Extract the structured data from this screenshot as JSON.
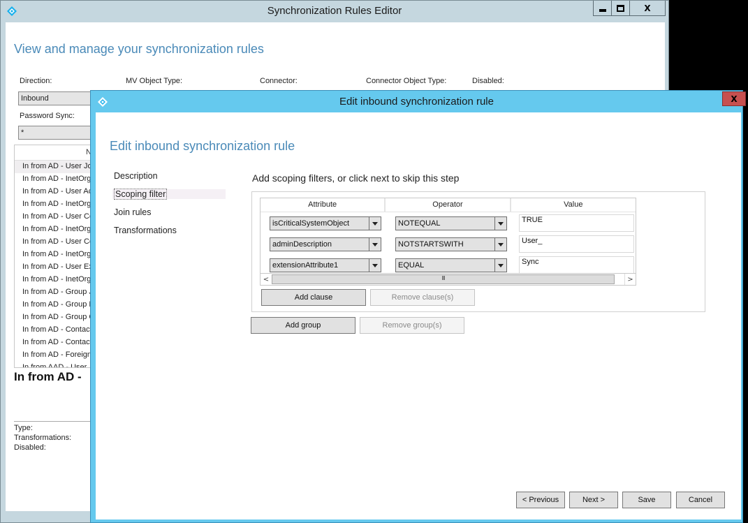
{
  "main_window": {
    "title": "Synchronization Rules Editor",
    "heading": "View and manage your synchronization rules",
    "window_controls": [
      "minimize",
      "maximize",
      "close"
    ],
    "close_label": "X",
    "filters": {
      "direction_label": "Direction:",
      "direction_value": "Inbound",
      "mv_object_type_label": "MV Object Type:",
      "connector_label": "Connector:",
      "connector_object_type_label": "Connector Object Type:",
      "disabled_label": "Disabled:",
      "password_sync_label": "Password Sync:",
      "password_sync_value": "*"
    },
    "rules_list": {
      "header": "Na",
      "rows": [
        "In from AD - User Join",
        "In from AD - InetOrgP",
        "In from AD - User Acc",
        "In from AD - InetOrgP",
        "In from AD - User Co",
        "In from AD - InetOrgP",
        "In from AD - User Co",
        "In from AD - InetOrgP",
        "In from AD - User Exc",
        "In from AD - InetOrgP",
        "In from AD - Group Jo",
        "In from AD - Group E",
        "In from AD - Group C",
        "In from AD - Contact",
        "In from AD - Contact",
        "In from AD - ForeignS",
        "In from AAD - User Jo"
      ],
      "selected_index": 0
    },
    "details": {
      "title": "In from AD -",
      "type_label": "Type:",
      "transformations_label": "Transformations:",
      "disabled_label": "Disabled:"
    }
  },
  "dialog": {
    "title": "Edit inbound synchronization rule",
    "heading": "Edit inbound synchronization rule",
    "close_label": "X",
    "nav": [
      {
        "label": "Description",
        "active": false
      },
      {
        "label": "Scoping filter",
        "active": true
      },
      {
        "label": "Join rules",
        "active": false
      },
      {
        "label": "Transformations",
        "active": false
      }
    ],
    "step_heading": "Add scoping filters, or click next to skip this step",
    "grid": {
      "columns": [
        "Attribute",
        "Operator",
        "Value"
      ],
      "rows": [
        {
          "attribute": "isCriticalSystemObject",
          "operator": "NOTEQUAL",
          "value": "TRUE"
        },
        {
          "attribute": "adminDescription",
          "operator": "NOTSTARTSWITH",
          "value": "User_"
        },
        {
          "attribute": "extensionAttribute1",
          "operator": "EQUAL",
          "value": "Sync"
        }
      ],
      "scroll_left": "<",
      "scroll_right": ">",
      "scroll_grip": "III"
    },
    "buttons": {
      "add_clause": "Add clause",
      "remove_clause": "Remove clause(s)",
      "add_group": "Add group",
      "remove_group": "Remove group(s)",
      "previous": "< Previous",
      "next": "Next >",
      "save": "Save",
      "cancel": "Cancel"
    }
  },
  "colors": {
    "accent_heading": "#4a8ab8",
    "dialog_frame": "#65c9ee",
    "main_frame": "#c5d7df",
    "close_button": "#c75050"
  }
}
